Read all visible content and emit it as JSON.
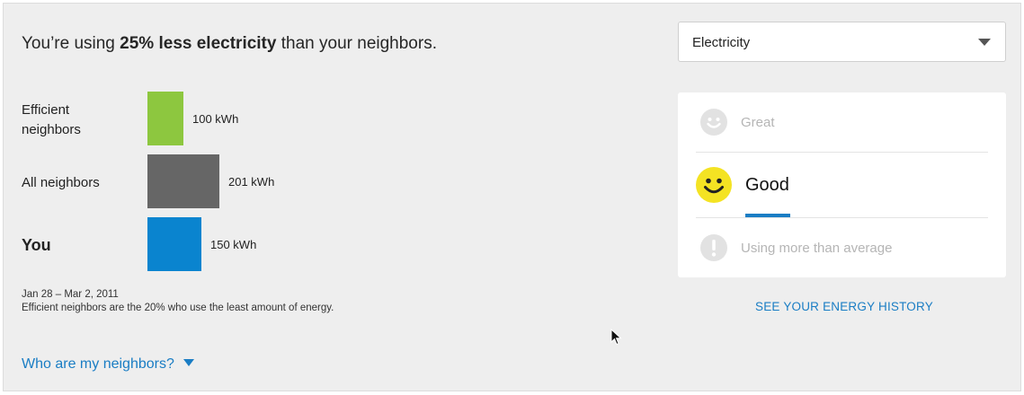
{
  "headline": {
    "prefix": "You’re using ",
    "emphasis": "25% less electricity",
    "suffix": " than your neighbors."
  },
  "fuel_select": {
    "value": "Electricity",
    "icon": "chevron-down-icon"
  },
  "comparison": {
    "rows": [
      {
        "label": "Efficient neighbors",
        "value_label": "100 kWh",
        "kwh": 100,
        "color": "#8dc73f"
      },
      {
        "label": "All neighbors",
        "value_label": "201 kWh",
        "kwh": 201,
        "color": "#666666"
      },
      {
        "label": "You",
        "value_label": "150 kWh",
        "kwh": 150,
        "color": "#0a84cf"
      }
    ]
  },
  "date_range": "Jan 28 – Mar 2, 2011",
  "footnote": "Efficient neighbors are the 20% who use the least amount of energy.",
  "who_link": "Who are my neighbors?",
  "rating": {
    "items": [
      {
        "label": "Great",
        "icon": "smiley-icon",
        "state": "inactive"
      },
      {
        "label": "Good",
        "icon": "smiley-icon",
        "state": "active"
      },
      {
        "label": "Using more than average",
        "icon": "exclamation-icon",
        "state": "inactive"
      }
    ]
  },
  "history_link": "SEE YOUR ENERGY HISTORY",
  "colors": {
    "accent": "#1a7dc4",
    "active_face": "#f4e323",
    "inactive": "#c8c8c8"
  }
}
